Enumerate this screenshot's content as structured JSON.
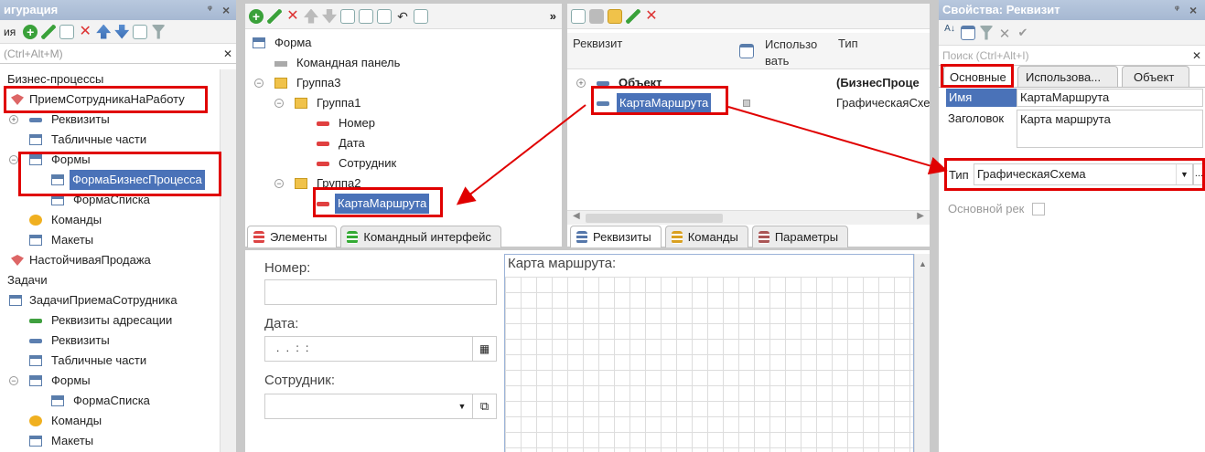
{
  "left": {
    "header": "игурация",
    "toolbar_label": "ия",
    "search_placeholder": "(Ctrl+Alt+M)",
    "tree": [
      {
        "label": "Бизнес-процессы"
      },
      {
        "label": "ПриемСотрудникаНаРаботу"
      },
      {
        "label": "Реквизиты"
      },
      {
        "label": "Табличные части"
      },
      {
        "label": "Формы"
      },
      {
        "label": "ФормаБизнесПроцесса"
      },
      {
        "label": "ФормаСписка"
      },
      {
        "label": "Команды"
      },
      {
        "label": "Макеты"
      },
      {
        "label": "НастойчиваяПродажа"
      },
      {
        "label": "Задачи"
      },
      {
        "label": "ЗадачиПриемаСотрудника"
      },
      {
        "label": "Реквизиты адресации"
      },
      {
        "label": "Реквизиты"
      },
      {
        "label": "Табличные части"
      },
      {
        "label": "Формы"
      },
      {
        "label": "ФормаСписка"
      },
      {
        "label": "Команды"
      },
      {
        "label": "Макеты"
      }
    ]
  },
  "elements": {
    "tree": [
      {
        "label": "Форма"
      },
      {
        "label": "Командная панель"
      },
      {
        "label": "Группа3"
      },
      {
        "label": "Группа1"
      },
      {
        "label": "Номер"
      },
      {
        "label": "Дата"
      },
      {
        "label": "Сотрудник"
      },
      {
        "label": "Группа2"
      },
      {
        "label": "КартаМаршрута"
      }
    ],
    "tabs": [
      "Элементы",
      "Командный интерфейс"
    ]
  },
  "attrs": {
    "columns": [
      "Реквизит",
      "Использо вать",
      "Тип"
    ],
    "rows": [
      {
        "name": "Объект",
        "type": "(БизнесПроце"
      },
      {
        "name": "КартаМаршрута",
        "type": "ГрафическаяСхе"
      }
    ],
    "tabs": [
      "Реквизиты",
      "Команды",
      "Параметры"
    ]
  },
  "form_preview": {
    "labels": [
      "Номер:",
      "Дата:",
      "Сотрудник:"
    ],
    "date_value": ".   .       :  :",
    "map_label": "Карта маршрута:"
  },
  "props": {
    "header": "Свойства: Реквизит",
    "search_placeholder": "Поиск (Ctrl+Alt+I)",
    "tabs": [
      "Основные",
      "Использова...",
      "Объект"
    ],
    "name_label": "Имя",
    "name_value": "КартаМаршрута",
    "title_label": "Заголовок",
    "title_value": "Карта маршрута",
    "type_label": "Тип",
    "type_value": "ГрафическаяСхема",
    "main_req_label": "Основной рек",
    "dots": "..."
  },
  "colors": {
    "selection": "#4a72b8",
    "highlight": "#e00000",
    "header": "#a6b8d2"
  }
}
